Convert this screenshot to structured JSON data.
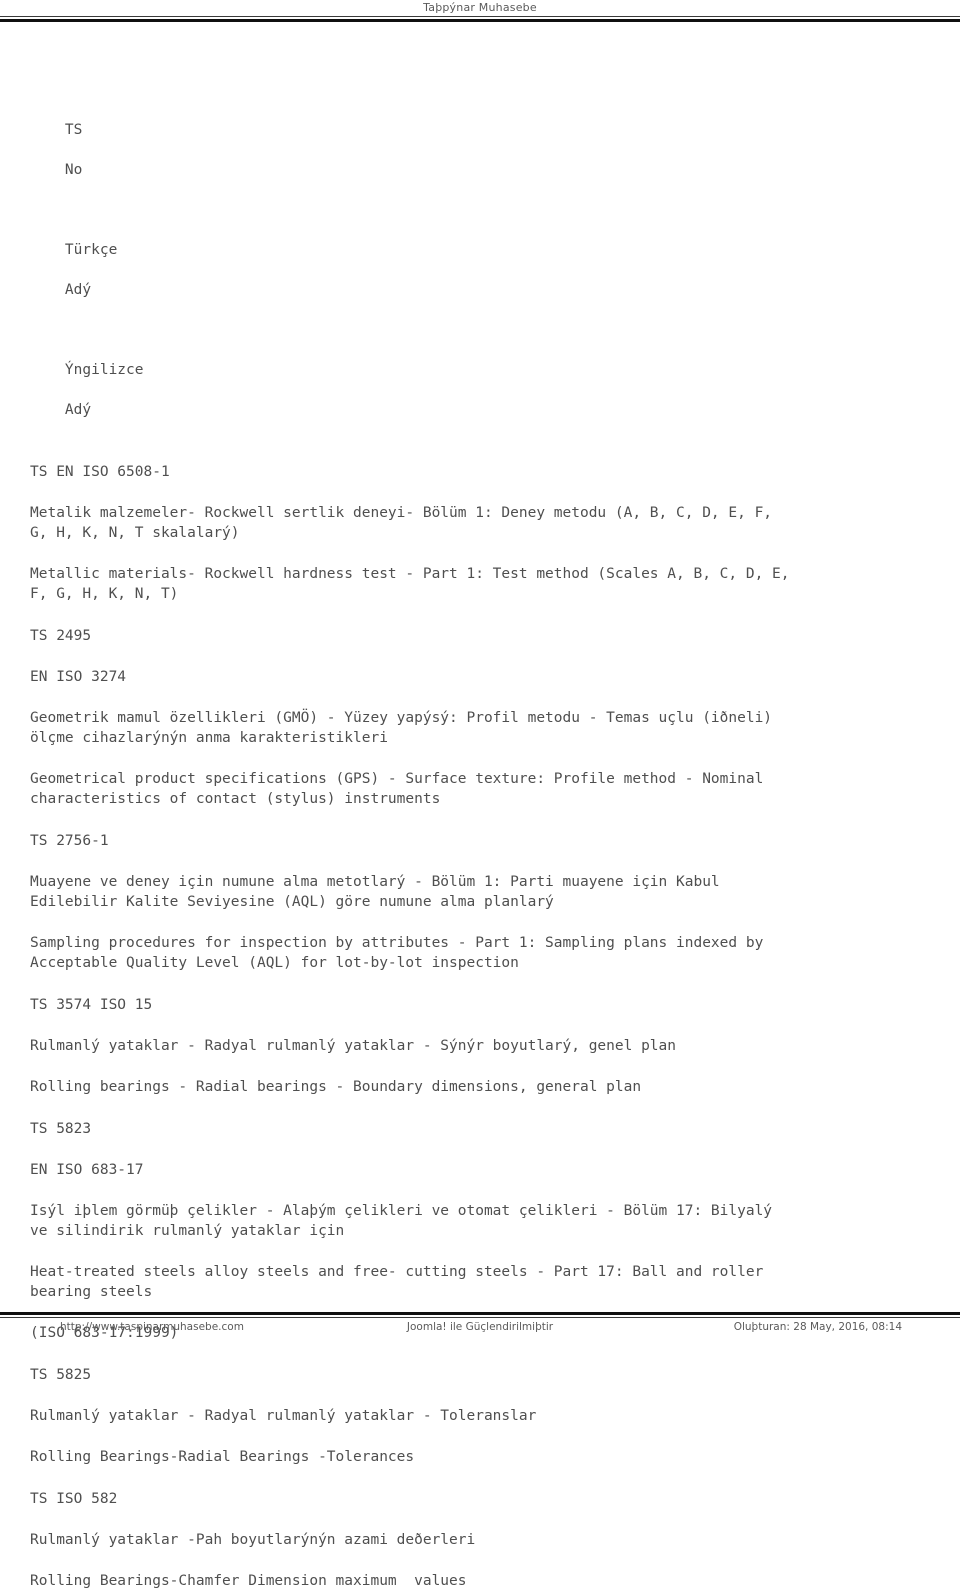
{
  "header": {
    "site_title": "Taþpýnar Muhasebe"
  },
  "columns": {
    "ts_line1": "TS",
    "ts_line2": "No",
    "turkish_line1": "Türkçe",
    "turkish_line2": "Adý",
    "english_line1": "Ýngilizce",
    "english_line2": "Adý"
  },
  "entries": [
    {
      "codes": [
        "TS EN ISO 6508-1"
      ],
      "turkish": "Metalik malzemeler- Rockwell sertlik deneyi- Bölüm 1: Deney metodu (A, B, C, D, E, F, G, H, K, N, T skalalarý)",
      "english": "Metallic materials- Rockwell hardness test - Part 1: Test method (Scales A, B, C, D, E, F, G, H, K, N, T)"
    },
    {
      "codes": [
        "TS 2495",
        "EN ISO 3274"
      ],
      "turkish": "Geometrik mamul özellikleri (GMÖ) - Yüzey yapýsý: Profil metodu - Temas uçlu (iðneli) ölçme cihazlarýnýn anma karakteristikleri",
      "english": "Geometrical product specifications (GPS) - Surface texture: Profile method - Nominal characteristics of contact (stylus) instruments"
    },
    {
      "codes": [
        "TS 2756-1"
      ],
      "turkish": "Muayene ve deney için numune alma metotlarý - Bölüm 1: Parti muayene için Kabul Edilebilir Kalite Seviyesine (AQL) göre numune alma planlarý",
      "english": "Sampling procedures for inspection by attributes - Part 1: Sampling plans indexed by Acceptable Quality Level (AQL) for lot-by-lot inspection"
    },
    {
      "codes": [
        "TS 3574 ISO 15"
      ],
      "turkish": "Rulmanlý yataklar - Radyal rulmanlý yataklar - Sýnýr boyutlarý, genel plan",
      "english": "Rolling bearings - Radial bearings - Boundary dimensions, general plan"
    },
    {
      "codes": [
        "TS 5823",
        "EN ISO 683-17"
      ],
      "turkish": "Isýl iþlem görmüþ çelikler - Alaþým çelikleri ve otomat çelikleri - Bölüm 17: Bilyalý ve silindirik rulmanlý yataklar için",
      "english": "Heat-treated steels alloy steels and free- cutting steels - Part 17: Ball and roller bearing steels",
      "note": "(ISO 683-17:1999)"
    },
    {
      "codes": [
        "TS 5825"
      ],
      "turkish": "Rulmanlý yataklar - Radyal rulmanlý yataklar - Toleranslar",
      "english": "Rolling Bearings-Radial Bearings -Tolerances"
    },
    {
      "codes": [
        "TS ISO 582"
      ],
      "turkish": "Rulmanlý yataklar -Pah boyutlarýnýn azami deðerleri",
      "english": "Rolling Bearings-Chamfer Dimension maximum  values"
    }
  ],
  "footer": {
    "url": "http://www.taspinarmuhasebe.com",
    "powered_by": "Joomla! ile Güçlendirilmiþtir",
    "generated": "Oluþturan: 28 May, 2016, 08:14"
  }
}
